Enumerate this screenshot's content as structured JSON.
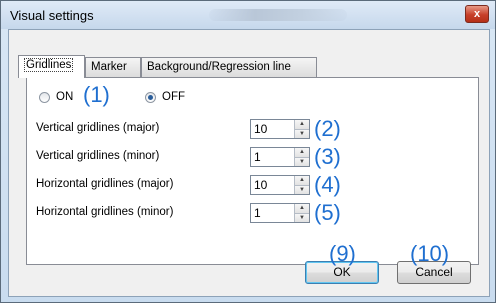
{
  "window": {
    "title": "Visual settings",
    "close_glyph": "x",
    "close_icon": "close-icon"
  },
  "tabs": [
    "Gridlines",
    "Marker",
    "Background/Regression line"
  ],
  "radios": {
    "on_label": "ON",
    "on_num": "(1)",
    "on_selected": false,
    "off_label": "OFF",
    "off_selected": true
  },
  "rows": [
    {
      "label": "Vertical gridlines (major)",
      "value": "10",
      "num": "(2)"
    },
    {
      "label": "Vertical gridlines (minor)",
      "value": "1",
      "num": "(3)"
    },
    {
      "label": "Horizontal gridlines (major)",
      "value": "10",
      "num": "(4)"
    },
    {
      "label": "Horizontal gridlines (minor)",
      "value": "1",
      "num": "(5)"
    }
  ],
  "buttons": {
    "ok_label": "OK",
    "ok_num": "(9)",
    "cancel_label": "Cancel",
    "cancel_num": "(10)"
  },
  "colors": {
    "annotation": "#1f6fd0",
    "title_bar": "#c6d8ec",
    "close_button": "#c7402a"
  }
}
